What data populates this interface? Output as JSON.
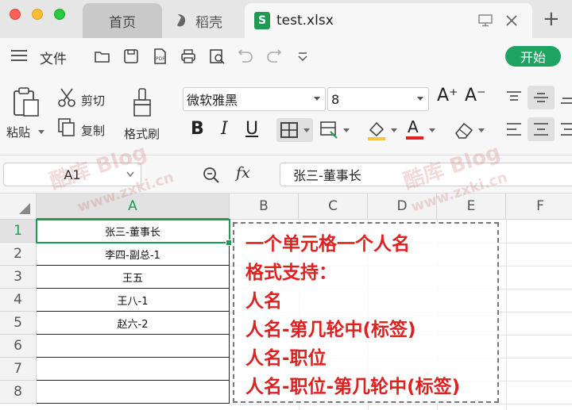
{
  "tabs": {
    "home_label": "首页",
    "daoke_label": "稻壳",
    "file_label": "test.xlsx",
    "xls_glyph": "S"
  },
  "menu": {
    "file_label": "文件",
    "start_label": "开始"
  },
  "ribbon": {
    "paste_label": "粘贴",
    "cut_label": "剪切",
    "copy_label": "复制",
    "format_painter_label": "格式刷",
    "font_name": "微软雅黑",
    "font_size": "8",
    "bold": "B",
    "italic": "I",
    "underline": "U",
    "grow_font": "A⁺",
    "shrink_font": "A⁻"
  },
  "formula_bar": {
    "cell_ref": "A1",
    "fx_label": "fx",
    "content": "张三-董事长"
  },
  "grid": {
    "columns": [
      "A",
      "B",
      "C",
      "D",
      "E",
      "F"
    ],
    "rows": [
      "1",
      "2",
      "3",
      "4",
      "5",
      "6",
      "7",
      "8"
    ],
    "col_a_values": [
      "张三-董事长",
      "李四-副总-1",
      "王五",
      "王八-1",
      "赵六-2",
      "",
      "",
      ""
    ]
  },
  "note": {
    "lines": [
      "一个单元格一个人名",
      "格式支持：",
      "人名",
      "人名-第几轮中(标签)",
      "人名-职位",
      "人名-职位-第几轮中(标签)"
    ]
  },
  "watermark": {
    "text_cn": "酷库 Blog",
    "text_url": "www.zxki.cn"
  },
  "colors": {
    "accent_green": "#1e9a52",
    "note_red": "#e02020"
  }
}
